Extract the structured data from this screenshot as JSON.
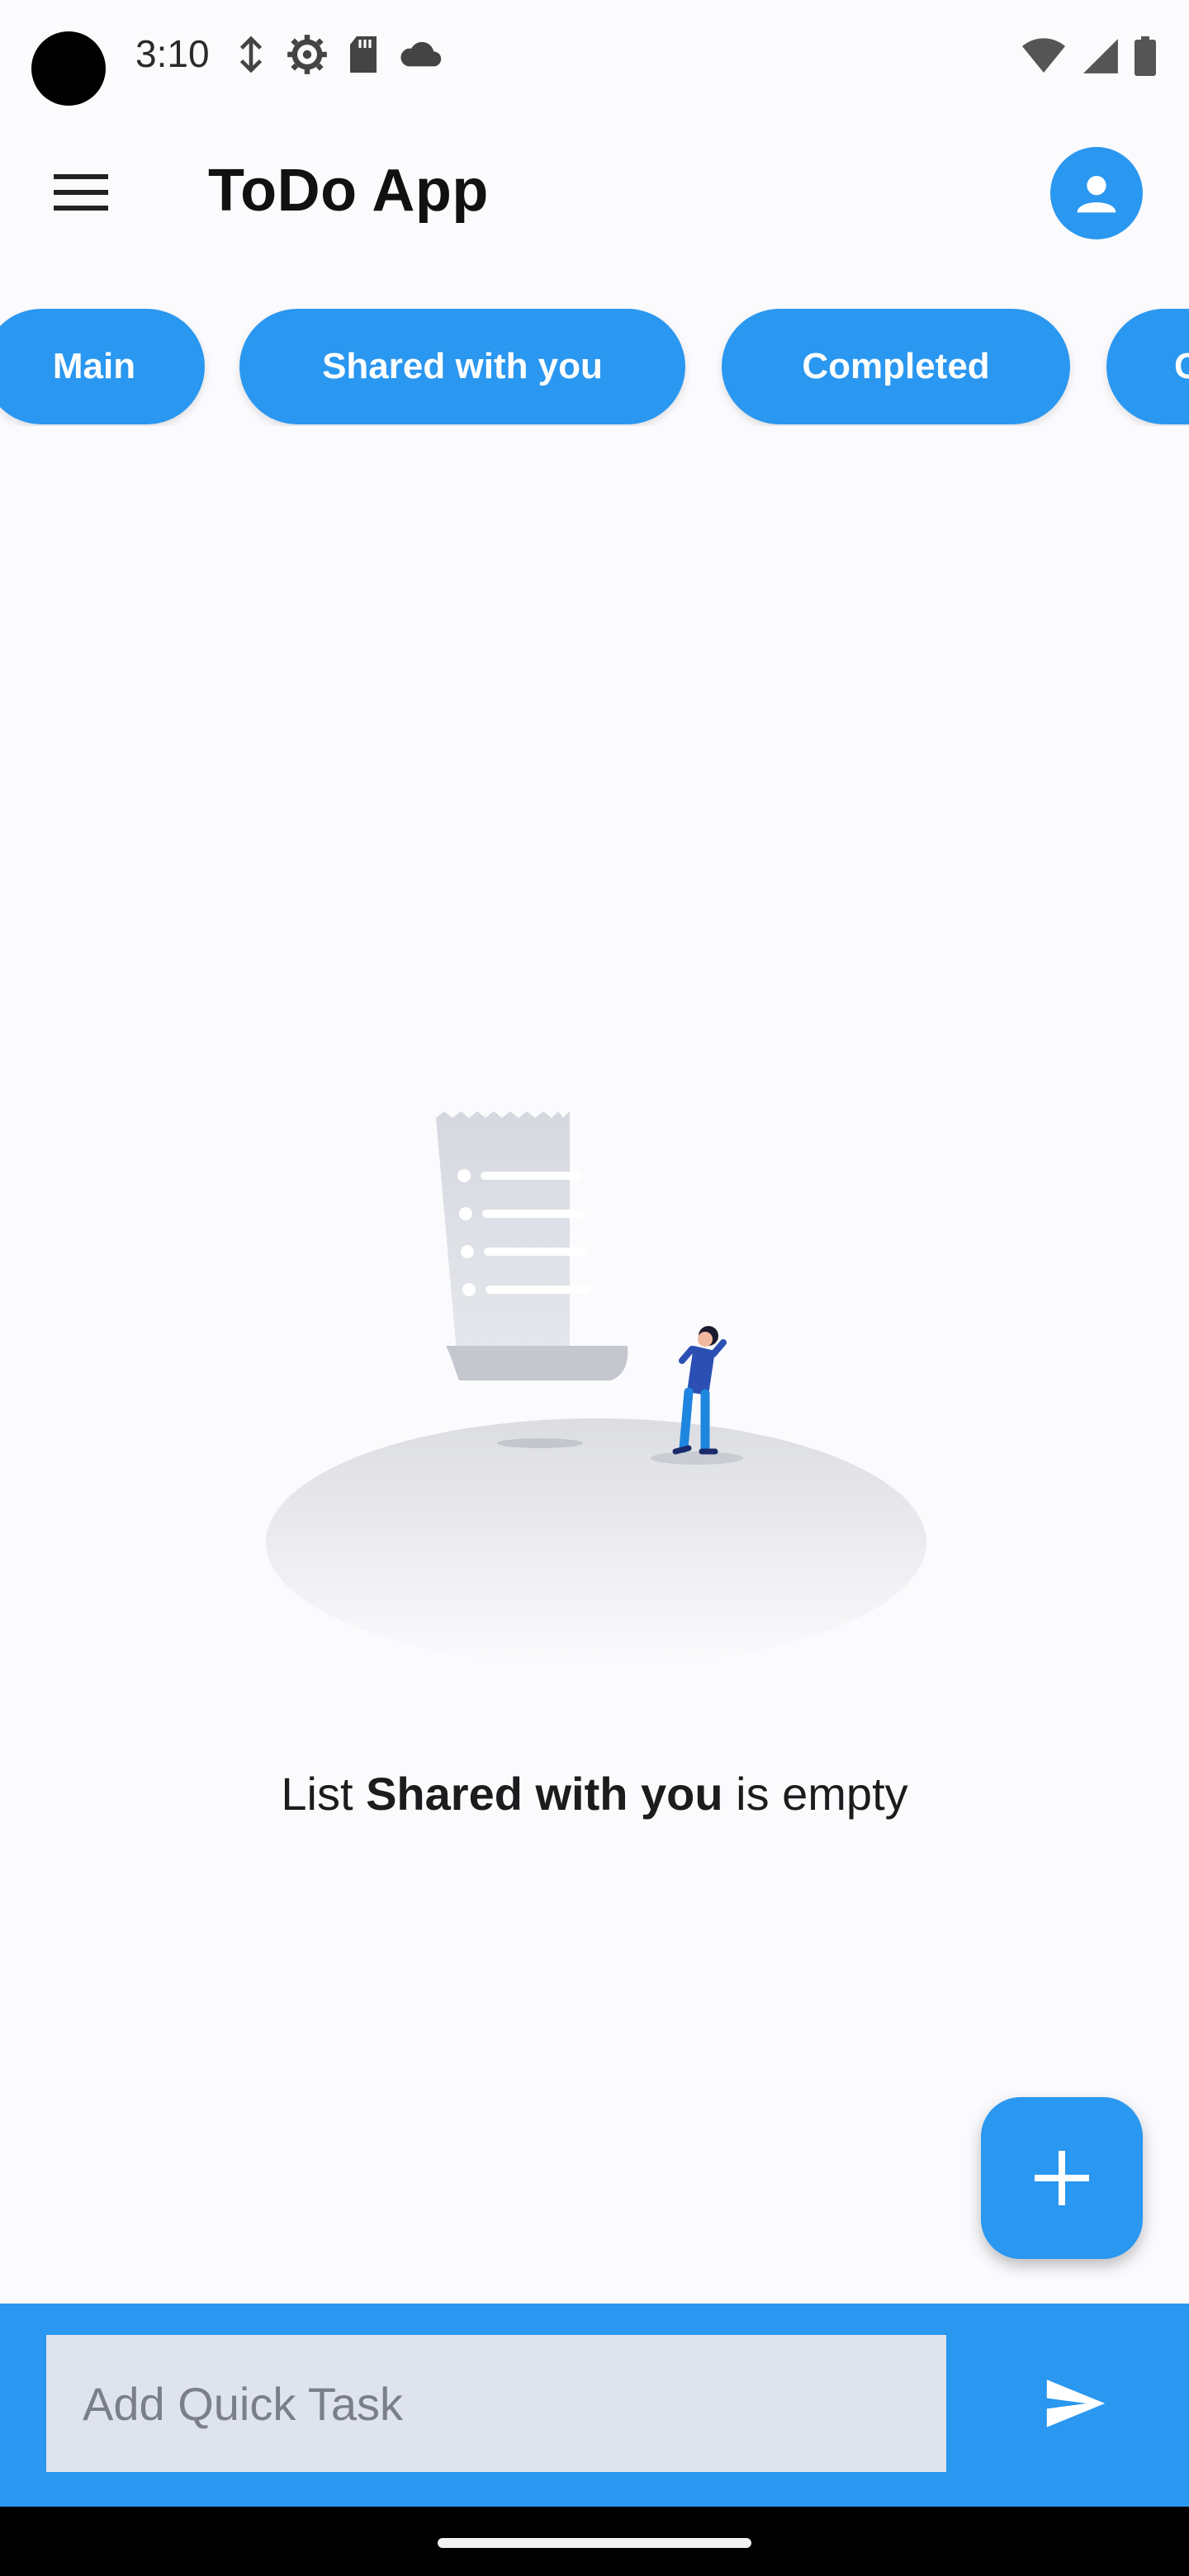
{
  "status_bar": {
    "time": "3:10",
    "left_icons": [
      "data-saver-icon",
      "settings-gear-icon",
      "sd-card-icon",
      "cloud-icon"
    ],
    "right_icons": [
      "wifi-icon",
      "signal-icon",
      "battery-icon"
    ]
  },
  "app_bar": {
    "title": "ToDo App",
    "menu_icon": "menu-icon",
    "account_icon": "account-icon"
  },
  "tabs": [
    {
      "label": "Main"
    },
    {
      "label": "Shared with you"
    },
    {
      "label": "Completed"
    },
    {
      "label": "C"
    }
  ],
  "empty_state": {
    "prefix": "List",
    "list_name": "Shared with you",
    "suffix": "is empty"
  },
  "fab": {
    "icon": "add-icon"
  },
  "quick_task": {
    "placeholder": "Add Quick Task",
    "send_icon": "send-icon"
  },
  "colors": {
    "accent": "#2a97f0",
    "background": "#fbfbfd",
    "input_bg": "#dfe3ec"
  }
}
